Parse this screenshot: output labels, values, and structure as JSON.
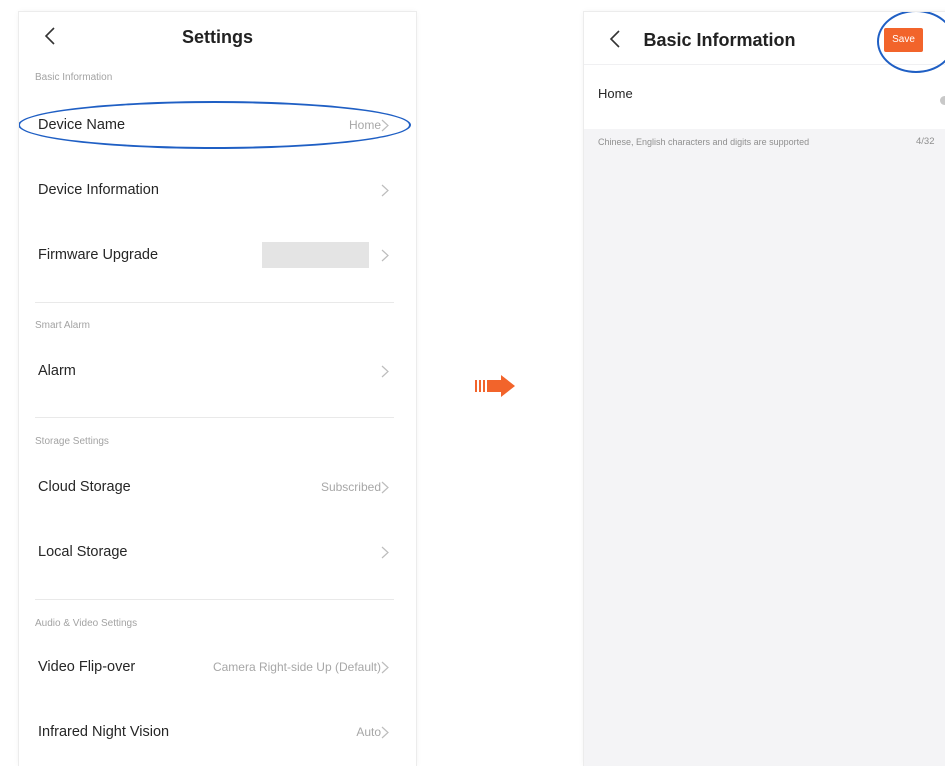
{
  "settings": {
    "title": "Settings",
    "sections": {
      "basic": "Basic Information",
      "alarm": "Smart Alarm",
      "storage": "Storage Settings",
      "av": "Audio & Video Settings"
    },
    "rows": {
      "device_name": {
        "label": "Device Name",
        "value": "Home"
      },
      "device_info": {
        "label": "Device Information"
      },
      "firmware": {
        "label": "Firmware Upgrade"
      },
      "alarm": {
        "label": "Alarm"
      },
      "cloud": {
        "label": "Cloud Storage",
        "value": "Subscribed"
      },
      "local": {
        "label": "Local Storage"
      },
      "flip": {
        "label": "Video Flip-over",
        "value": "Camera Right-side Up (Default)"
      },
      "infrared": {
        "label": "Infrared Night Vision",
        "value": "Auto"
      }
    }
  },
  "basic_info": {
    "title": "Basic Information",
    "save_label": "Save",
    "name_value": "Home",
    "hint": "Chinese, English characters and digits are supported",
    "count": "4/32"
  },
  "colors": {
    "accent": "#f2642b",
    "highlight_oval": "#1f5fc4",
    "hint_background": "#f4f4f6"
  },
  "icons": [
    "back-arrow-icon",
    "chevron-right-icon",
    "clear-icon",
    "flow-arrow-icon"
  ]
}
